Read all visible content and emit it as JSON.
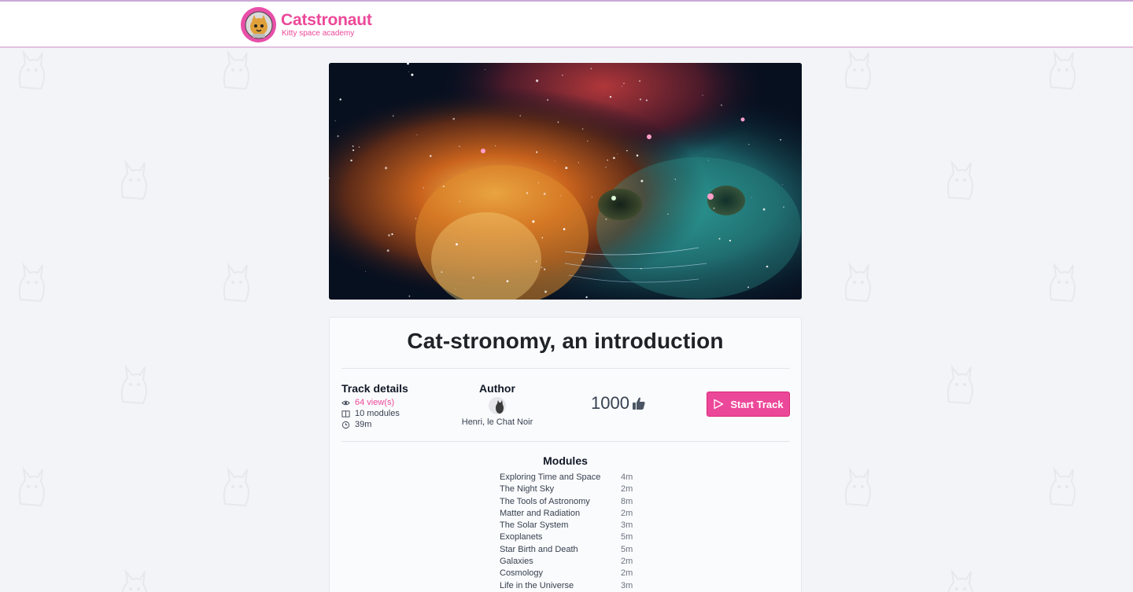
{
  "brand": {
    "name": "Catstronaut",
    "tagline": "Kitty space academy",
    "logo_icon": "astronaut-cat-icon",
    "color": "#ec4899"
  },
  "track": {
    "title": "Cat-stronomy, an introduction",
    "details_heading": "Track details",
    "views": "64 view(s)",
    "modules_count": "10 modules",
    "duration": "39m",
    "author_heading": "Author",
    "author_name": "Henri, le Chat Noir",
    "likes": "1000",
    "start_label": "Start Track"
  },
  "modules": {
    "heading": "Modules",
    "items": [
      {
        "name": "Exploring Time and Space",
        "duration": "4m"
      },
      {
        "name": "The Night Sky",
        "duration": "2m"
      },
      {
        "name": "The Tools of Astronomy",
        "duration": "8m"
      },
      {
        "name": "Matter and Radiation",
        "duration": "2m"
      },
      {
        "name": "The Solar System",
        "duration": "3m"
      },
      {
        "name": "Exoplanets",
        "duration": "5m"
      },
      {
        "name": "Star Birth and Death",
        "duration": "5m"
      },
      {
        "name": "Galaxies",
        "duration": "2m"
      },
      {
        "name": "Cosmology",
        "duration": "2m"
      },
      {
        "name": "Life in the Universe",
        "duration": "3m"
      }
    ]
  },
  "icons": {
    "views": "eye-icon",
    "modules": "book-icon",
    "duration": "clock-icon",
    "likes": "thumbs-up-icon",
    "start": "play-icon"
  }
}
